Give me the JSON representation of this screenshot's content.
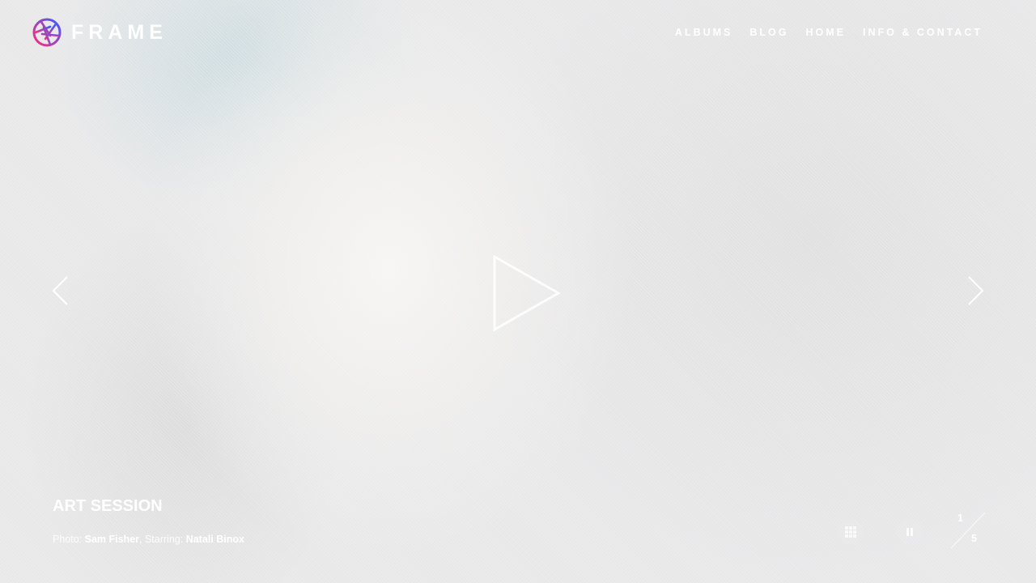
{
  "brand": {
    "name": "FRAME"
  },
  "nav": {
    "items": [
      "ALBUMS",
      "BLOG",
      "HOME",
      "INFO & CONTACT"
    ]
  },
  "slide": {
    "title": "ART SESSION",
    "photo_label": "Photo:",
    "photographer": "Sam Fisher",
    "starring_label": ", Starring:",
    "model": "Natali Binox"
  },
  "icons": {
    "logo": "aperture-icon",
    "prev": "chevron-left-icon",
    "next": "chevron-right-icon",
    "play": "play-icon",
    "grid": "grid-icon",
    "pause": "pause-icon"
  },
  "counter": {
    "current": "1",
    "total": "5"
  },
  "colors": {
    "logo_gradient": [
      "#ff2d7a",
      "#3d5bff"
    ],
    "text": "#ffffff"
  }
}
